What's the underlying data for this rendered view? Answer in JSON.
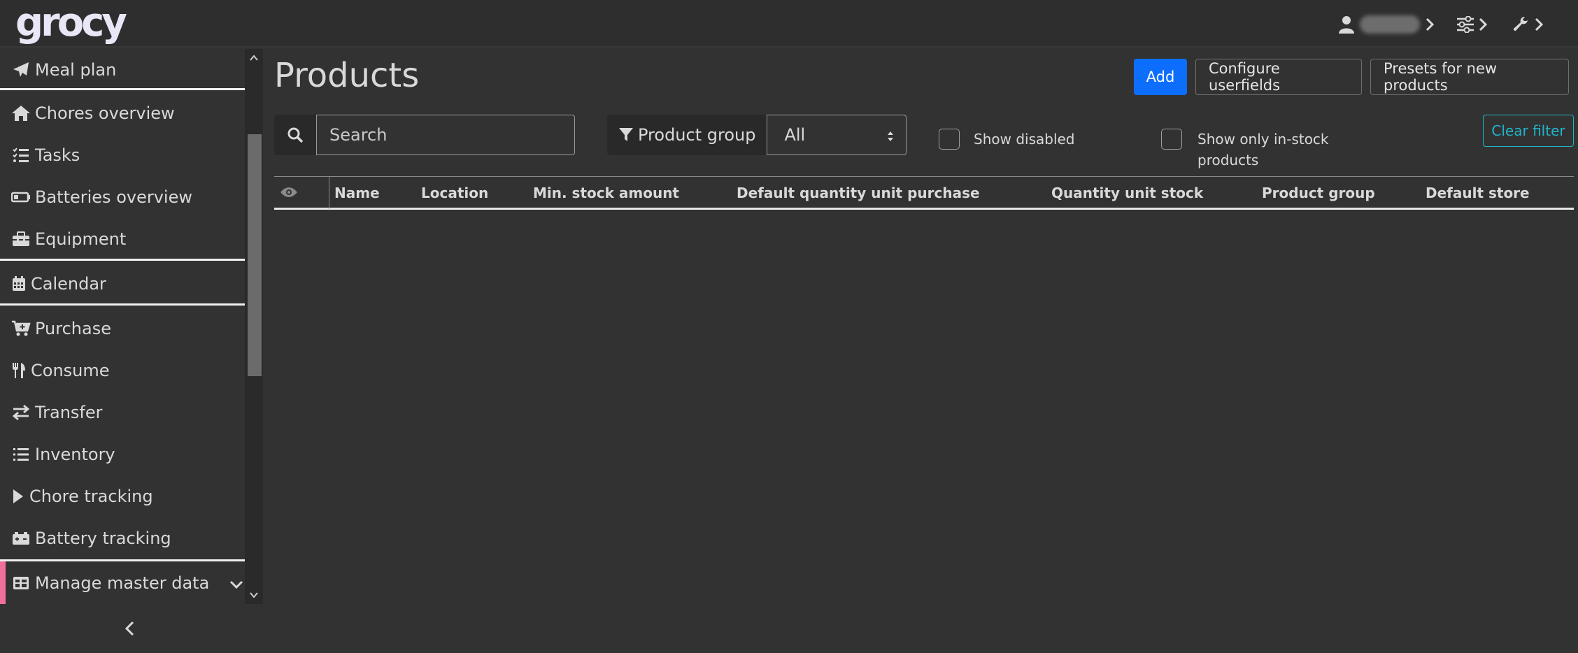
{
  "app": {
    "logo": "grocy"
  },
  "topbar": {
    "user_icon": "user-icon",
    "settings_icon": "sliders-icon",
    "tools_icon": "wrench-icon"
  },
  "sidebar": {
    "items": [
      {
        "label": "Meal plan",
        "icon": "paper-plane-icon"
      },
      {
        "label": "Chores overview",
        "icon": "home-icon"
      },
      {
        "label": "Tasks",
        "icon": "tasks-icon"
      },
      {
        "label": "Batteries overview",
        "icon": "battery-icon"
      },
      {
        "label": "Equipment",
        "icon": "toolbox-icon"
      },
      {
        "label": "Calendar",
        "icon": "calendar-icon"
      },
      {
        "label": "Purchase",
        "icon": "cart-icon"
      },
      {
        "label": "Consume",
        "icon": "utensils-icon"
      },
      {
        "label": "Transfer",
        "icon": "exchange-icon"
      },
      {
        "label": "Inventory",
        "icon": "list-icon"
      },
      {
        "label": "Chore tracking",
        "icon": "play-icon"
      },
      {
        "label": "Battery tracking",
        "icon": "car-battery-icon"
      },
      {
        "label": "Manage master data",
        "icon": "table-icon"
      }
    ]
  },
  "main": {
    "title": "Products",
    "buttons": {
      "add": "Add",
      "configure": "Configure userfields",
      "presets": "Presets for new products",
      "clear": "Clear filter"
    },
    "search": {
      "placeholder": "Search"
    },
    "filter": {
      "label": "Product group",
      "selected": "All"
    },
    "checkboxes": {
      "show_disabled": "Show disabled",
      "in_stock_line1": "Show only in-stock",
      "in_stock_line2": "products"
    },
    "table": {
      "columns": [
        "Name",
        "Location",
        "Min. stock amount",
        "Default quantity unit purchase",
        "Quantity unit stock",
        "Product group",
        "Default store"
      ]
    }
  },
  "colors": {
    "background": "#333233",
    "primary": "#0d6efd",
    "info": "#1fb5c8",
    "active_marker": "#f0709a"
  }
}
